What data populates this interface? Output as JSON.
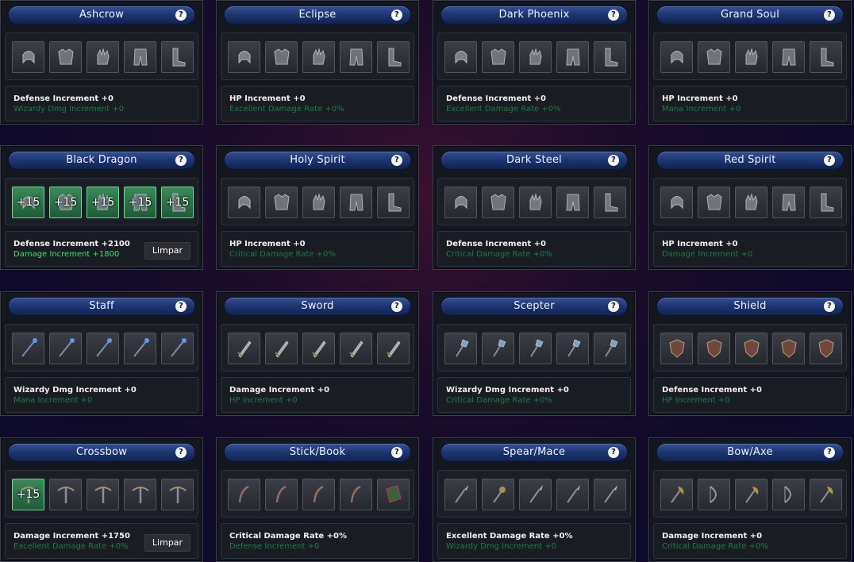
{
  "panels": [
    {
      "title": "Ashcrow",
      "stat1": "Defense Increment +0",
      "stat2": "Wizardy Dmg Increment +0",
      "stat2_on": false,
      "clear": "",
      "slots": [
        "",
        "",
        "",
        "",
        ""
      ],
      "items": [
        "helm-icon",
        "armor-icon",
        "gloves-icon",
        "pants-icon",
        "boots-icon"
      ]
    },
    {
      "title": "Eclipse",
      "stat1": "HP Increment +0",
      "stat2": "Excellent Damage Rate +0%",
      "stat2_on": false,
      "clear": "",
      "slots": [
        "",
        "",
        "",
        "",
        ""
      ],
      "items": [
        "helm-icon",
        "armor-icon",
        "gloves-icon",
        "pants-icon",
        "boots-icon"
      ]
    },
    {
      "title": "Dark Phoenix",
      "stat1": "Defense Increment +0",
      "stat2": "Excellent Damage Rate +0%",
      "stat2_on": false,
      "clear": "",
      "slots": [
        "",
        "",
        "",
        "",
        ""
      ],
      "items": [
        "helm-icon",
        "armor-icon",
        "gloves-icon",
        "pants-icon",
        "boots-icon"
      ]
    },
    {
      "title": "Grand Soul",
      "stat1": "HP Increment +0",
      "stat2": "Mana Increment +0",
      "stat2_on": false,
      "clear": "",
      "slots": [
        "",
        "",
        "",
        "",
        ""
      ],
      "items": [
        "helm-icon",
        "armor-icon",
        "gloves-icon",
        "pants-icon",
        "boots-icon"
      ]
    },
    {
      "title": "Black Dragon",
      "stat1": "Defense Increment +2100",
      "stat2": "Damage Increment +1800",
      "stat2_on": true,
      "clear": "Limpar",
      "slots": [
        "+15",
        "+15",
        "+15",
        "+15",
        "+15"
      ],
      "items": [
        "helm-icon",
        "armor-icon",
        "gloves-icon",
        "pants-icon",
        "boots-icon"
      ]
    },
    {
      "title": "Holy Spirit",
      "stat1": "HP Increment +0",
      "stat2": "Critical Damage Rate +0%",
      "stat2_on": false,
      "clear": "",
      "slots": [
        "",
        "",
        "",
        "",
        ""
      ],
      "items": [
        "helm-icon",
        "armor-icon",
        "gloves-icon",
        "pants-icon",
        "boots-icon"
      ]
    },
    {
      "title": "Dark Steel",
      "stat1": "Defense Increment +0",
      "stat2": "Critical Damage Rate +0%",
      "stat2_on": false,
      "clear": "",
      "slots": [
        "",
        "",
        "",
        "",
        ""
      ],
      "items": [
        "helm-icon",
        "armor-icon",
        "gloves-icon",
        "pants-icon",
        "boots-icon"
      ]
    },
    {
      "title": "Red Spirit",
      "stat1": "HP Increment +0",
      "stat2": "Damage Increment +0",
      "stat2_on": false,
      "clear": "",
      "slots": [
        "",
        "",
        "",
        "",
        ""
      ],
      "items": [
        "helm-icon",
        "armor-icon",
        "gloves-icon",
        "pants-icon",
        "boots-icon"
      ]
    },
    {
      "title": "Staff",
      "stat1": "Wizardy Dmg Increment +0",
      "stat2": "Mana Increment +0",
      "stat2_on": false,
      "clear": "",
      "slots": [
        "",
        "",
        "",
        "",
        ""
      ],
      "items": [
        "staff-icon",
        "staff-icon",
        "staff-icon",
        "staff-icon",
        "staff-icon"
      ]
    },
    {
      "title": "Sword",
      "stat1": "Damage Increment +0",
      "stat2": "HP Increment +0",
      "stat2_on": false,
      "clear": "",
      "slots": [
        "",
        "",
        "",
        "",
        ""
      ],
      "items": [
        "sword-icon",
        "sword-icon",
        "sword-icon",
        "sword-icon",
        "sword-icon"
      ]
    },
    {
      "title": "Scepter",
      "stat1": "Wizardy Dmg Increment +0",
      "stat2": "Critical Damage Rate +0%",
      "stat2_on": false,
      "clear": "",
      "slots": [
        "",
        "",
        "",
        "",
        ""
      ],
      "items": [
        "scepter-icon",
        "scepter-icon",
        "scepter-icon",
        "scepter-icon",
        "scepter-icon"
      ]
    },
    {
      "title": "Shield",
      "stat1": "Defense Increment +0",
      "stat2": "HP Increment +0",
      "stat2_on": false,
      "clear": "",
      "slots": [
        "",
        "",
        "",
        "",
        ""
      ],
      "items": [
        "shield-icon",
        "shield-icon",
        "shield-icon",
        "shield-icon",
        "shield-icon"
      ]
    },
    {
      "title": "Crossbow",
      "stat1": "Damage Increment +1750",
      "stat2": "Excellent Damage Rate +0%",
      "stat2_on": false,
      "clear": "Limpar",
      "slots": [
        "+15",
        "",
        "",
        "",
        ""
      ],
      "items": [
        "crossbow-icon",
        "crossbow-icon",
        "crossbow-icon",
        "crossbow-icon",
        "crossbow-icon"
      ]
    },
    {
      "title": "Stick/Book",
      "stat1": "Critical Damage Rate +0%",
      "stat2": "Defense Increment +0",
      "stat2_on": false,
      "clear": "",
      "slots": [
        "",
        "",
        "",
        "",
        ""
      ],
      "items": [
        "stick-icon",
        "stick-icon",
        "stick-icon",
        "stick-icon",
        "book-icon"
      ]
    },
    {
      "title": "Spear/Mace",
      "stat1": "Excellent Damage Rate +0%",
      "stat2": "Wizardy Dmg Increment +0",
      "stat2_on": false,
      "clear": "",
      "slots": [
        "",
        "",
        "",
        "",
        ""
      ],
      "items": [
        "spear-icon",
        "mace-icon",
        "spear-icon",
        "spear-icon",
        "spear-icon"
      ]
    },
    {
      "title": "Bow/Axe",
      "stat1": "Damage Increment +0",
      "stat2": "Critical Damage Rate +0%",
      "stat2_on": false,
      "clear": "",
      "slots": [
        "",
        "",
        "",
        "",
        ""
      ],
      "items": [
        "axe-icon",
        "bow-icon",
        "axe-icon",
        "bow-icon",
        "axe-icon"
      ]
    }
  ],
  "help_glyph": "?"
}
